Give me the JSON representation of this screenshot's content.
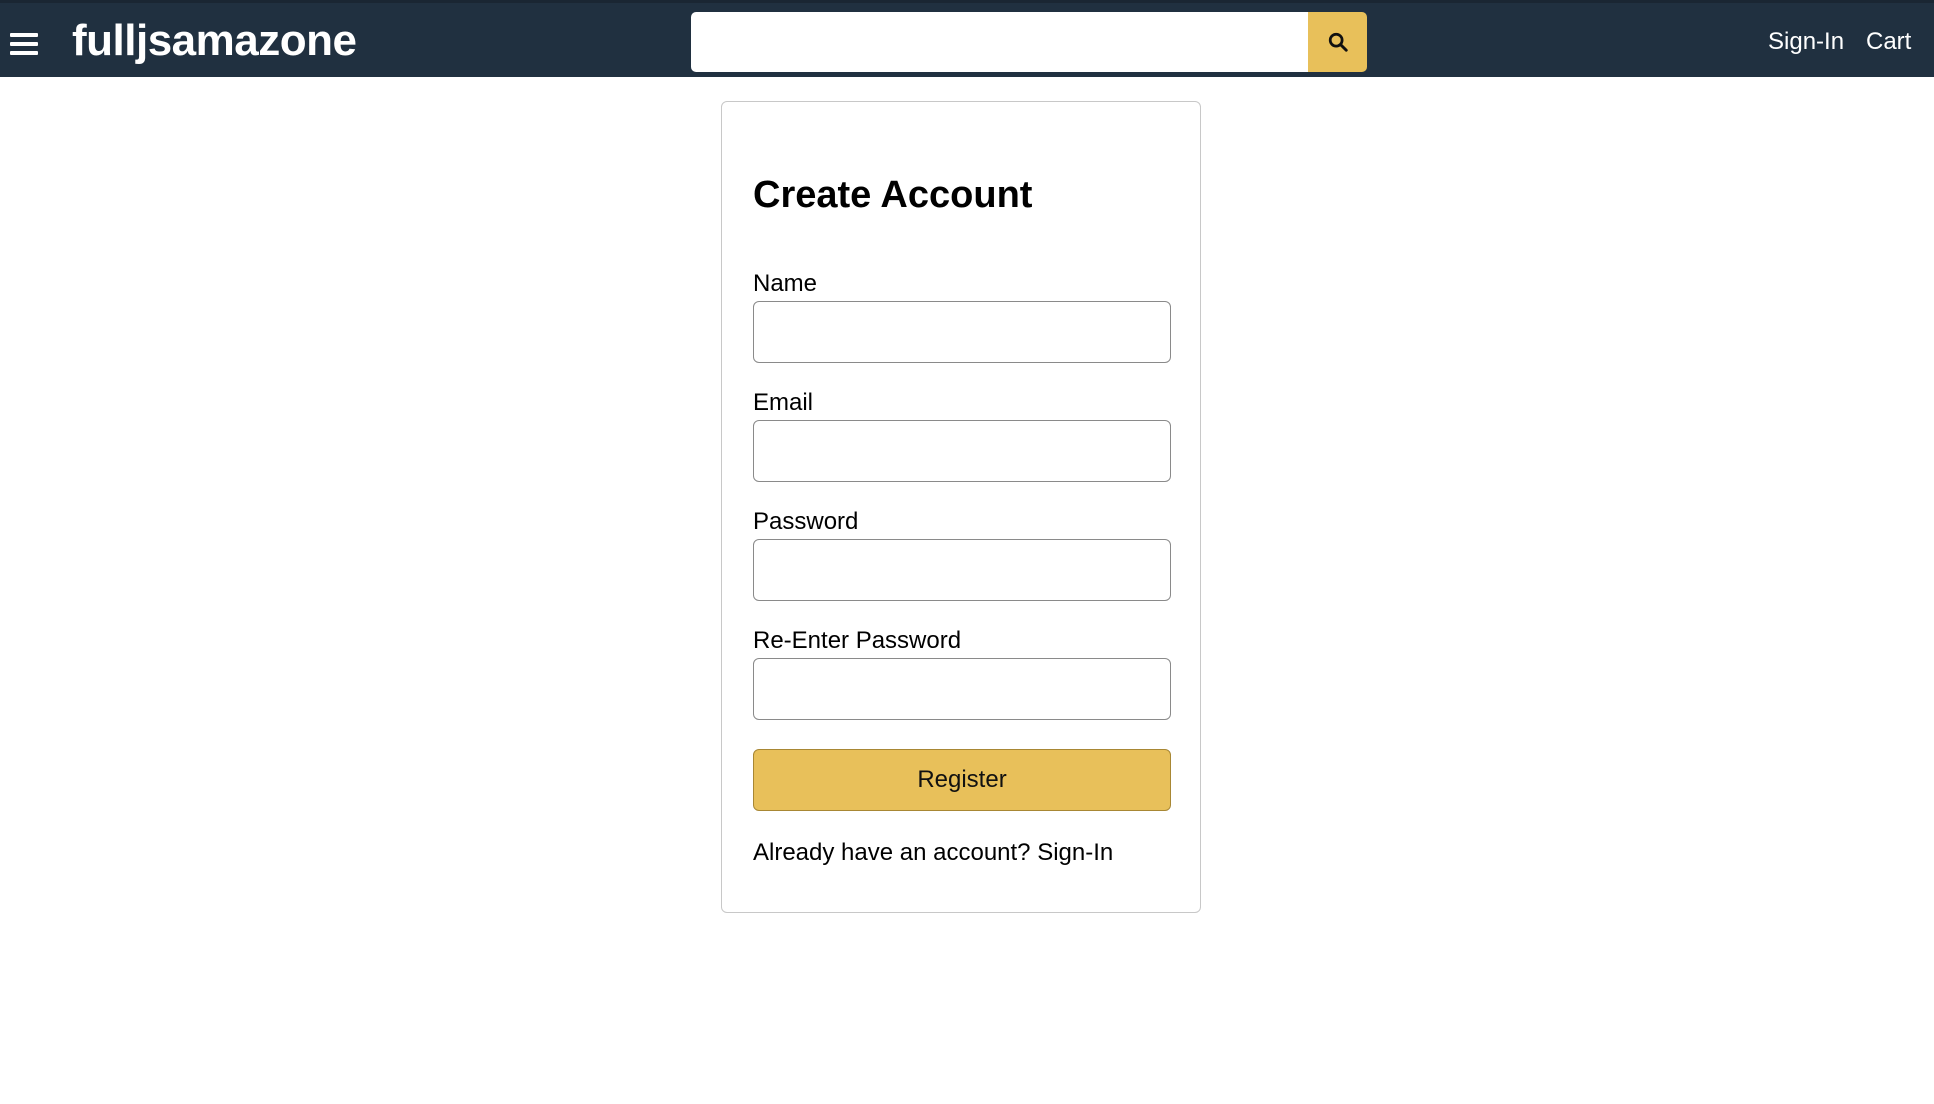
{
  "header": {
    "brand": "fulljsamazone",
    "search": {
      "value": "",
      "placeholder": ""
    },
    "links": {
      "sign_in": "Sign-In",
      "cart": "Cart"
    },
    "icons": {
      "menu": "hamburger-menu-icon",
      "search": "search-icon"
    },
    "colors": {
      "background": "#203040",
      "accent": "#e8c05a"
    }
  },
  "form": {
    "title": "Create Account",
    "fields": [
      {
        "label": "Name",
        "value": ""
      },
      {
        "label": "Email",
        "value": ""
      },
      {
        "label": "Password",
        "value": ""
      },
      {
        "label": "Re-Enter Password",
        "value": ""
      }
    ],
    "submit_label": "Register",
    "signin_prompt": "Already have an account?",
    "signin_link": "Sign-In"
  }
}
